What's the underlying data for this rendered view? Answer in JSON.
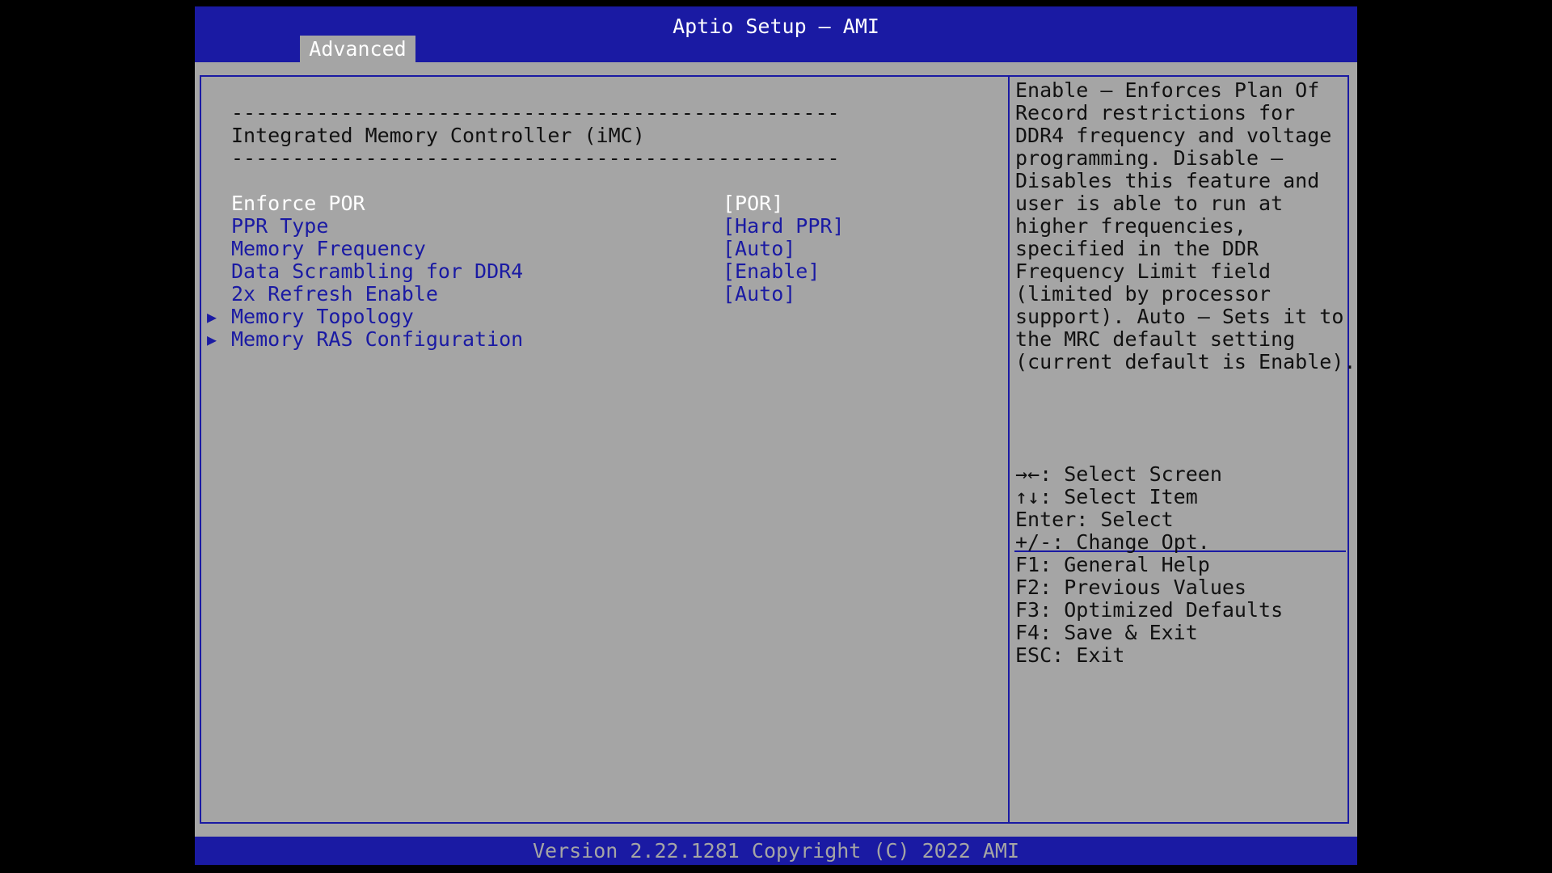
{
  "header": {
    "title": "Aptio Setup – AMI",
    "tabs": [
      "Advanced"
    ]
  },
  "main": {
    "separator": "--------------------------------------------------",
    "section_title": "Integrated Memory Controller (iMC)",
    "items": [
      {
        "label": "Enforce POR",
        "value": "[POR]"
      },
      {
        "label": "PPR Type",
        "value": "[Hard PPR]"
      },
      {
        "label": "Memory Frequency",
        "value": "[Auto]"
      },
      {
        "label": "Data Scrambling for DDR4",
        "value": "[Enable]"
      },
      {
        "label": "2x Refresh Enable",
        "value": "[Auto]"
      }
    ],
    "submenus": [
      {
        "label": "Memory Topology",
        "arrow": "▶"
      },
      {
        "label": "Memory RAS Configuration",
        "arrow": "▶"
      }
    ]
  },
  "help": {
    "lines": [
      "Enable – Enforces Plan Of",
      "Record restrictions for",
      "DDR4 frequency and voltage",
      "programming. Disable –",
      "Disables this feature and",
      "user is able to run at",
      "higher frequencies,",
      "specified in the DDR",
      "Frequency Limit field",
      "(limited by processor",
      "support). Auto – Sets it to",
      "the MRC default setting",
      "(current default is Enable)."
    ]
  },
  "keys": [
    {
      "key": "→←:",
      "action": "Select Screen",
      "icon": "left-right-arrows-icon"
    },
    {
      "key": "↑↓:",
      "action": "Select Item",
      "icon": "up-down-arrows-icon"
    },
    {
      "key": "Enter:",
      "action": "Select"
    },
    {
      "key": "+/-:",
      "action": "Change Opt."
    },
    {
      "key": "F1:",
      "action": "General Help"
    },
    {
      "key": "F2:",
      "action": "Previous Values"
    },
    {
      "key": "F3:",
      "action": "Optimized Defaults"
    },
    {
      "key": "F4:",
      "action": "Save & Exit"
    },
    {
      "key": "ESC:",
      "action": "Exit"
    }
  ],
  "footer": {
    "version": "Version 2.22.1281 Copyright (C) 2022 AMI"
  },
  "colors": {
    "background": "#000000",
    "panel": "#a5a5a5",
    "bar": "#1a1aa3",
    "text_dark": "#111111",
    "text_blue": "#1a1aa3",
    "text_highlight": "#ffffff"
  }
}
